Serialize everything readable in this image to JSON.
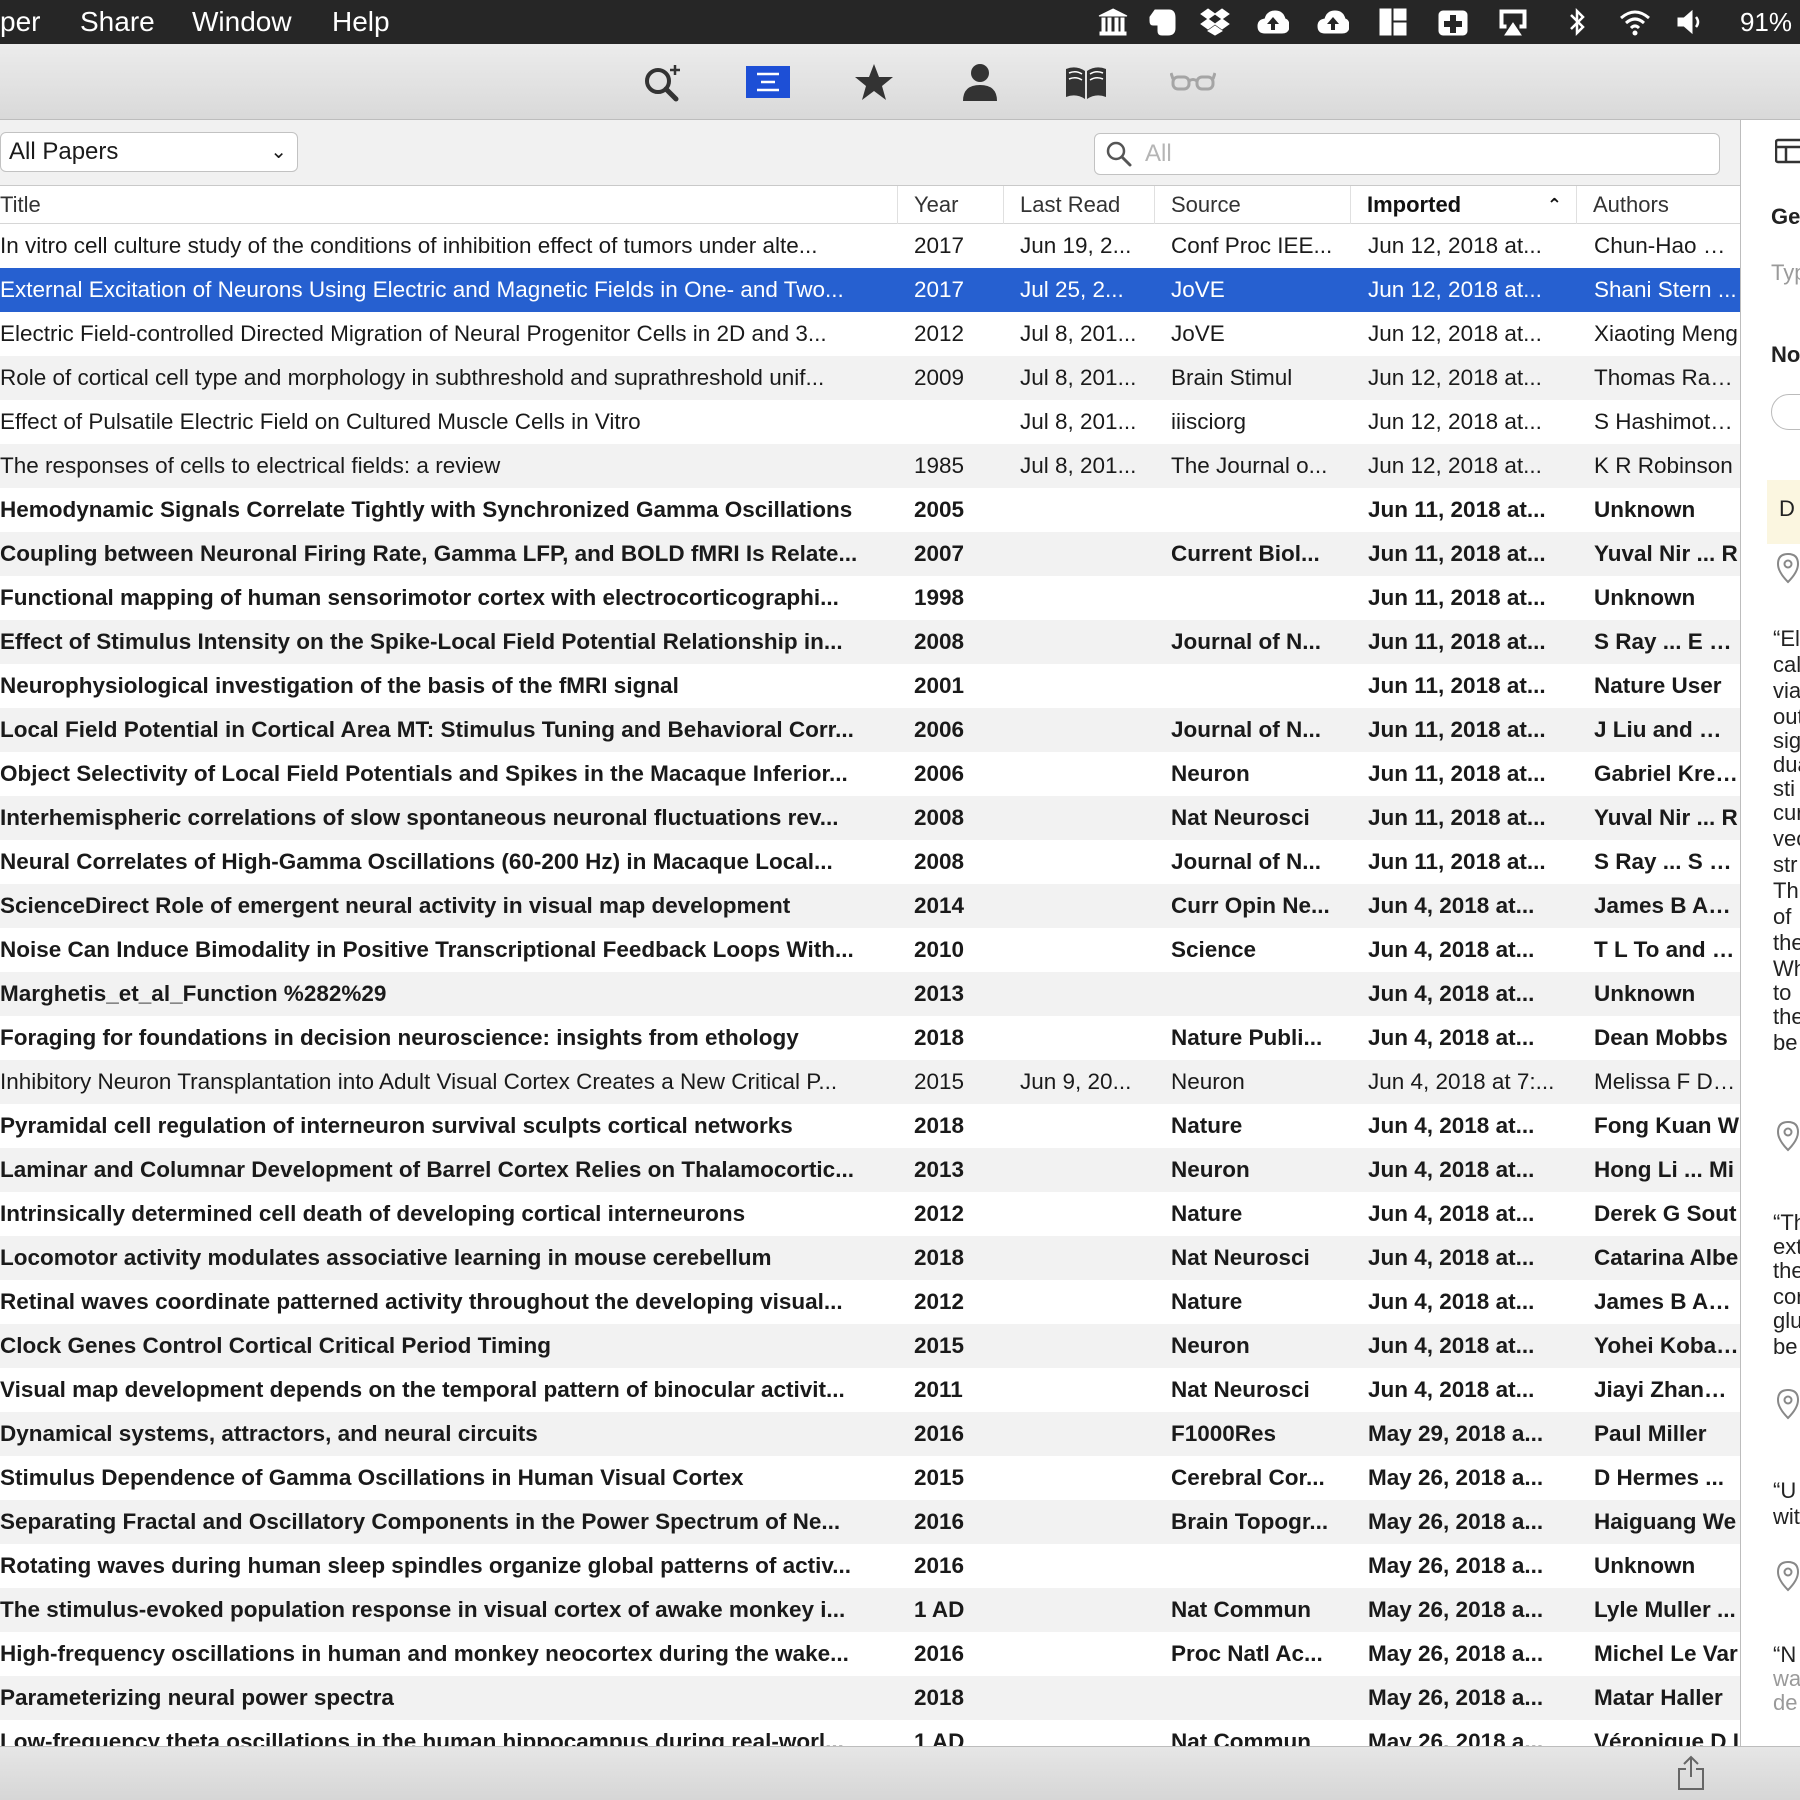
{
  "menubar": {
    "items": [
      "per",
      "Share",
      "Window",
      "Help"
    ],
    "battery": "91%"
  },
  "toolbar": {
    "active": "library-view"
  },
  "filter": {
    "collection": "All Papers",
    "search_placeholder": "All"
  },
  "columns": {
    "title": "Title",
    "year": "Year",
    "last_read": "Last Read",
    "source": "Source",
    "imported": "Imported",
    "authors": "Authors"
  },
  "rows": [
    {
      "title": "In vitro cell culture study of the conditions of inhibition effect of tumors under alte...",
      "year": "2017",
      "last_read": "Jun 19, 2...",
      "source": "Conf Proc IEE...",
      "imported": "Jun 12, 2018 at...",
      "authors": "Chun-Hao Hua",
      "unread": false
    },
    {
      "title": "External Excitation of Neurons Using Electric and Magnetic Fields in One- and Two...",
      "year": "2017",
      "last_read": "Jul 25, 2...",
      "source": "JoVE",
      "imported": "Jun 12, 2018 at...",
      "authors": "Shani Stern ...",
      "unread": false,
      "selected": true
    },
    {
      "title": "Electric Field-controlled Directed Migration of Neural Progenitor Cells in 2D and 3...",
      "year": "2012",
      "last_read": "Jul 8, 201...",
      "source": "JoVE",
      "imported": "Jun 12, 2018 at...",
      "authors": "Xiaoting Meng",
      "unread": false
    },
    {
      "title": "Role of cortical cell type and morphology in subthreshold and suprathreshold unif...",
      "year": "2009",
      "last_read": "Jul 8, 201...",
      "source": "Brain Stimul",
      "imported": "Jun 12, 2018 at...",
      "authors": "Thomas Radm",
      "unread": false
    },
    {
      "title": "Effect of Pulsatile Electric Field on Cultured Muscle Cells in Vitro",
      "year": "",
      "last_read": "Jul 8, 201...",
      "source": "iiisciorg",
      "imported": "Jun 12, 2018 at...",
      "authors": "S Hashimoto ...",
      "unread": false
    },
    {
      "title": "The responses of cells to electrical fields: a review",
      "year": "1985",
      "last_read": "Jul 8, 201...",
      "source": "The Journal o...",
      "imported": "Jun 12, 2018 at...",
      "authors": "K R Robinson",
      "unread": false
    },
    {
      "title": "Hemodynamic Signals Correlate Tightly with Synchronized Gamma Oscillations",
      "year": "2005",
      "last_read": "",
      "source": "",
      "imported": "Jun 11, 2018 at...",
      "authors": "Unknown",
      "unread": true
    },
    {
      "title": "Coupling between Neuronal Firing Rate, Gamma LFP, and BOLD fMRI Is Relate...",
      "year": "2007",
      "last_read": "",
      "source": "Current Biol...",
      "imported": "Jun 11, 2018 at...",
      "authors": "Yuval Nir ... R",
      "unread": true
    },
    {
      "title": "Functional mapping of human sensorimotor cortex with electrocorticographi...",
      "year": "1998",
      "last_read": "",
      "source": "",
      "imported": "Jun 11, 2018 at...",
      "authors": "Unknown",
      "unread": true
    },
    {
      "title": "Effect of Stimulus Intensity on the Spike-Local Field Potential Relationship in...",
      "year": "2008",
      "last_read": "",
      "source": "Journal of N...",
      "imported": "Jun 11, 2018 at...",
      "authors": "S Ray ... E Nie",
      "unread": true
    },
    {
      "title": "Neurophysiological investigation of the basis of the fMRI signal",
      "year": "2001",
      "last_read": "",
      "source": "",
      "imported": "Jun 11, 2018 at...",
      "authors": "Nature User",
      "unread": true
    },
    {
      "title": "Local Field Potential in Cortical Area MT: Stimulus Tuning and Behavioral Corr...",
      "year": "2006",
      "last_read": "",
      "source": "Journal of N...",
      "imported": "Jun 11, 2018 at...",
      "authors": "J Liu and W T",
      "unread": true
    },
    {
      "title": "Object Selectivity of Local Field Potentials and Spikes in the Macaque Inferior...",
      "year": "2006",
      "last_read": "",
      "source": "Neuron",
      "imported": "Jun 11, 2018 at...",
      "authors": "Gabriel Kreim",
      "unread": true
    },
    {
      "title": "Interhemispheric correlations of slow spontaneous neuronal fluctuations rev...",
      "year": "2008",
      "last_read": "",
      "source": "Nat Neurosci",
      "imported": "Jun 11, 2018 at...",
      "authors": "Yuval Nir ... R",
      "unread": true
    },
    {
      "title": "Neural Correlates of High-Gamma Oscillations (60-200 Hz) in Macaque Local...",
      "year": "2008",
      "last_read": "",
      "source": "Journal of N...",
      "imported": "Jun 11, 2018 at...",
      "authors": "S Ray ... S S H",
      "unread": true
    },
    {
      "title": "ScienceDirect Role of emergent neural activity in visual map development",
      "year": "2014",
      "last_read": "",
      "source": "Curr Opin Ne...",
      "imported": "Jun 4, 2018 at...",
      "authors": "James B Ackm",
      "unread": true
    },
    {
      "title": "Noise Can Induce Bimodality in Positive Transcriptional Feedback Loops With...",
      "year": "2010",
      "last_read": "",
      "source": "Science",
      "imported": "Jun 4, 2018 at...",
      "authors": "T L To and N I",
      "unread": true
    },
    {
      "title": "Marghetis_et_al_Function %282%29",
      "year": "2013",
      "last_read": "",
      "source": "",
      "imported": "Jun 4, 2018 at...",
      "authors": "Unknown",
      "unread": true
    },
    {
      "title": "Foraging for foundations in decision neuroscience: insights from ethology",
      "year": "2018",
      "last_read": "",
      "source": "Nature Publi...",
      "imported": "Jun 4, 2018 at...",
      "authors": "Dean Mobbs",
      "unread": true
    },
    {
      "title": "Inhibitory Neuron Transplantation into Adult Visual Cortex Creates a New Critical P...",
      "year": "2015",
      "last_read": "Jun 9, 20...",
      "source": "Neuron",
      "imported": "Jun 4, 2018 at 7:...",
      "authors": "Melissa F Davi",
      "unread": false
    },
    {
      "title": "Pyramidal cell regulation of interneuron survival sculpts cortical networks",
      "year": "2018",
      "last_read": "",
      "source": "Nature",
      "imported": "Jun 4, 2018 at...",
      "authors": "Fong Kuan W",
      "unread": true
    },
    {
      "title": "Laminar and Columnar Development of Barrel Cortex Relies on Thalamocortic...",
      "year": "2013",
      "last_read": "",
      "source": "Neuron",
      "imported": "Jun 4, 2018 at...",
      "authors": "Hong Li ... Mi",
      "unread": true
    },
    {
      "title": "Intrinsically determined cell death of developing cortical interneurons",
      "year": "2012",
      "last_read": "",
      "source": "Nature",
      "imported": "Jun 4, 2018 at...",
      "authors": "Derek G Sout",
      "unread": true
    },
    {
      "title": "Locomotor activity modulates associative learning in mouse cerebellum",
      "year": "2018",
      "last_read": "",
      "source": "Nat Neurosci",
      "imported": "Jun 4, 2018 at...",
      "authors": "Catarina Albe",
      "unread": true
    },
    {
      "title": "Retinal waves coordinate patterned activity throughout the developing visual...",
      "year": "2012",
      "last_read": "",
      "source": "Nature",
      "imported": "Jun 4, 2018 at...",
      "authors": "James B Ackm",
      "unread": true
    },
    {
      "title": "Clock Genes Control Cortical Critical Period Timing",
      "year": "2015",
      "last_read": "",
      "source": "Neuron",
      "imported": "Jun 4, 2018 at...",
      "authors": "Yohei Kobaya",
      "unread": true
    },
    {
      "title": "Visual map development depends on the temporal pattern of binocular activit...",
      "year": "2011",
      "last_read": "",
      "source": "Nat Neurosci",
      "imported": "Jun 4, 2018 at...",
      "authors": "Jiayi Zhang ...",
      "unread": true
    },
    {
      "title": "Dynamical systems, attractors, and neural circuits",
      "year": "2016",
      "last_read": "",
      "source": "F1000Res",
      "imported": "May 29, 2018 a...",
      "authors": "Paul Miller",
      "unread": true
    },
    {
      "title": "Stimulus Dependence of Gamma Oscillations in Human Visual Cortex",
      "year": "2015",
      "last_read": "",
      "source": "Cerebral Cor...",
      "imported": "May 26, 2018 a...",
      "authors": "D Hermes ...",
      "unread": true
    },
    {
      "title": "Separating Fractal and Oscillatory Components in the Power Spectrum of Ne...",
      "year": "2016",
      "last_read": "",
      "source": "Brain Topogr...",
      "imported": "May 26, 2018 a...",
      "authors": "Haiguang We",
      "unread": true
    },
    {
      "title": "Rotating waves during human sleep spindles organize global patterns of activ...",
      "year": "2016",
      "last_read": "",
      "source": "",
      "imported": "May 26, 2018 a...",
      "authors": "Unknown",
      "unread": true
    },
    {
      "title": "The stimulus-evoked population response in visual cortex of awake monkey i...",
      "year": "1 AD",
      "last_read": "",
      "source": "Nat Commun",
      "imported": "May 26, 2018 a...",
      "authors": "Lyle Muller ...",
      "unread": true
    },
    {
      "title": "High-frequency oscillations in human and monkey neocortex during the wake...",
      "year": "2016",
      "last_read": "",
      "source": "Proc Natl Ac...",
      "imported": "May 26, 2018 a...",
      "authors": "Michel Le Var",
      "unread": true
    },
    {
      "title": "Parameterizing neural power spectra",
      "year": "2018",
      "last_read": "",
      "source": "",
      "imported": "May 26, 2018 a...",
      "authors": "Matar Haller",
      "unread": true
    },
    {
      "title": "Low-frequency theta oscillations in the human hippocampus during real-worl...",
      "year": "1 AD",
      "last_read": "",
      "source": "Nat Commun",
      "imported": "May 26, 2018 a...",
      "authors": "Véronique D I",
      "unread": true
    }
  ],
  "inspector": {
    "labels": [
      "Gen",
      "Typ",
      "No",
      "D"
    ],
    "quotes": [
      "“El",
      "cal",
      "via",
      "out",
      "sig",
      "dua",
      "sti",
      "cur",
      "vec",
      "str",
      "Th",
      "of",
      "the",
      "Wh",
      "to",
      "the",
      "be",
      "“Th",
      "ext",
      "the",
      "cor",
      "glu",
      "be",
      "“U",
      "wit",
      "“N",
      "wa",
      "de"
    ]
  }
}
